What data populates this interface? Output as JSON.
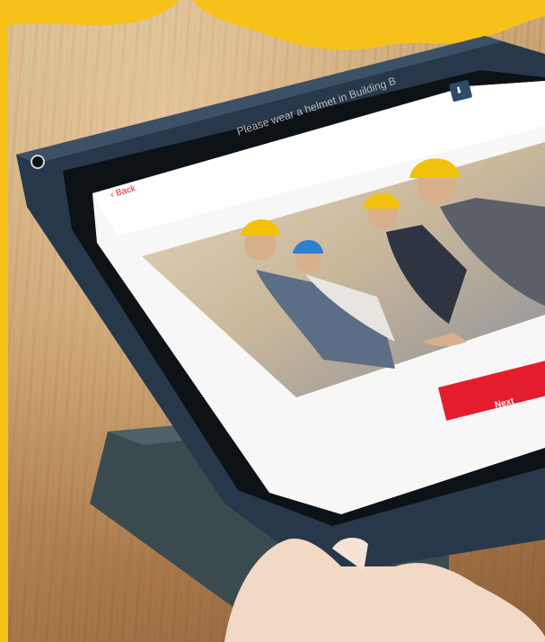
{
  "screen": {
    "instruction": "Please wear a helmet in Building B",
    "back_label": "Back",
    "next_label": "Next"
  },
  "icons": {
    "back": "chevron-left-icon",
    "download": "download-icon",
    "camera": "camera-icon"
  },
  "colors": {
    "accent": "#e41d2e",
    "frame": "#27384a",
    "brand_yellow": "#f6c21a"
  }
}
